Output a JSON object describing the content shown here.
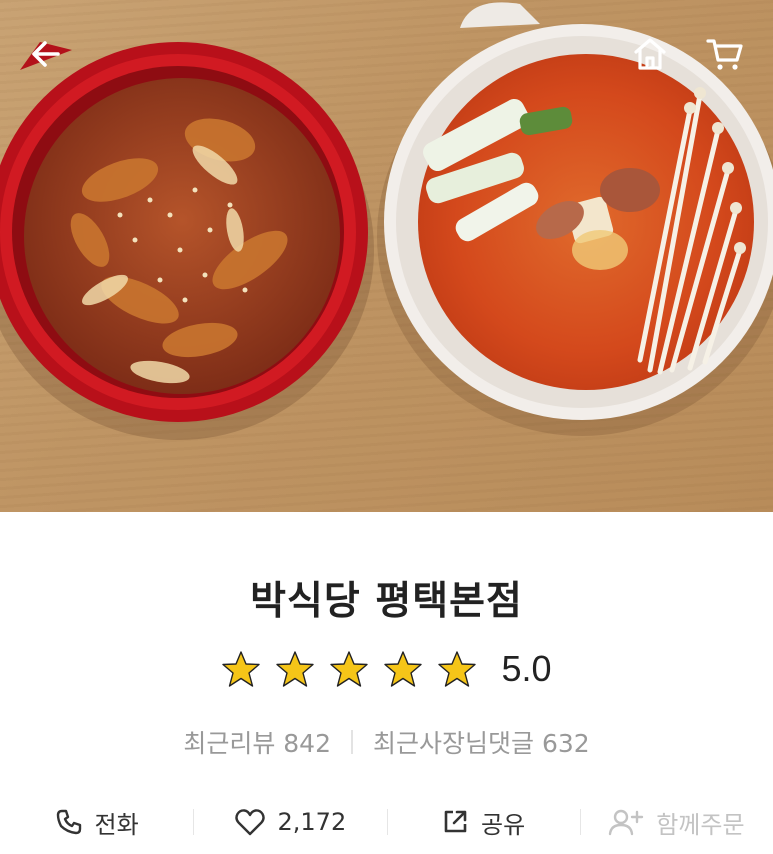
{
  "nav": {
    "back_icon": "arrow-left-icon",
    "home_icon": "home-icon",
    "cart_icon": "cart-icon"
  },
  "hero": {
    "image_alt": "",
    "colors": {
      "table": "#c49a6a",
      "red_bowl": "#c0121a",
      "white_bowl": "#f2eeea",
      "stew": "#d9481e"
    }
  },
  "store": {
    "name": "박식당 평택본점",
    "rating": {
      "stars": 5,
      "max_stars": 5,
      "value": "5.0",
      "star_icon": "star-icon",
      "star_color": "#f5c518"
    },
    "recent_review_label": "최근리뷰",
    "recent_review_count": "842",
    "recent_owner_reply_label": "최근사장님댓글",
    "recent_owner_reply_count": "632"
  },
  "actions": {
    "call": {
      "label": "전화",
      "icon": "phone-icon"
    },
    "like": {
      "label": "2,172",
      "icon": "heart-icon"
    },
    "share": {
      "label": "공유",
      "icon": "share-icon"
    },
    "group_order": {
      "label": "함께주문",
      "icon": "add-person-icon"
    }
  }
}
